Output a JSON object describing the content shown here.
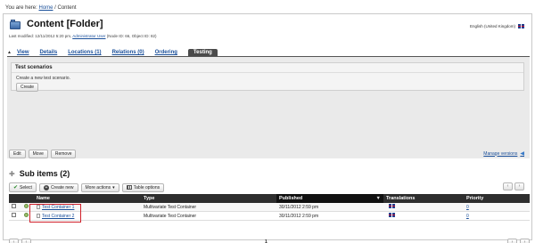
{
  "breadcrumb": {
    "prefix": "You are here:",
    "home": "Home",
    "sep": "/",
    "current": "Content"
  },
  "page": {
    "title": "Content [Folder]",
    "language": "English (United Kingdom)"
  },
  "lastmod": {
    "prefix": "Last modified: 12/11/2012 5:20 pm,",
    "user": "Administrator User",
    "suffix": "(Node ID: 66, Object ID: 82)"
  },
  "tabs": [
    {
      "label": "View",
      "active": false
    },
    {
      "label": "Details",
      "active": false
    },
    {
      "label": "Locations (1)",
      "active": false
    },
    {
      "label": "Relations (0)",
      "active": false
    },
    {
      "label": "Ordering",
      "active": false
    },
    {
      "label": "Testing",
      "active": true
    }
  ],
  "testing": {
    "heading": "Test scenarios",
    "text": "Create a new test scenario.",
    "button": "Create"
  },
  "actions": {
    "edit": "Edit",
    "move": "Move",
    "remove": "Remove",
    "manage_versions": "Manage versions"
  },
  "subitems": {
    "title": "Sub items (2)",
    "toolbar": {
      "select": "Select",
      "create_new": "Create new",
      "more_actions": "More actions",
      "table_options": "Table options"
    },
    "columns": {
      "name": "Name",
      "type": "Type",
      "published": "Published",
      "translations": "Translations",
      "priority": "Priority"
    },
    "rows": [
      {
        "name": "Test Container 1",
        "type": "Multivariate Test Container",
        "published": "30/11/2012 2:59 pm",
        "priority": "0"
      },
      {
        "name": "Test Container 2",
        "type": "Multivariate Test Container",
        "published": "30/11/2012 2:59 pm",
        "priority": "0"
      }
    ],
    "page_number": "1"
  },
  "icons": {
    "prev": "‹",
    "next": "›",
    "tab_toggle": "▲",
    "sort": "▼",
    "plus": "✚",
    "check": "✔",
    "create": "+",
    "manage": "◀",
    "dropdown": "▾"
  },
  "colors": {
    "link": "#1a4f9a",
    "highlight": "#d0202a",
    "header_bg": "#2e2e2e"
  }
}
